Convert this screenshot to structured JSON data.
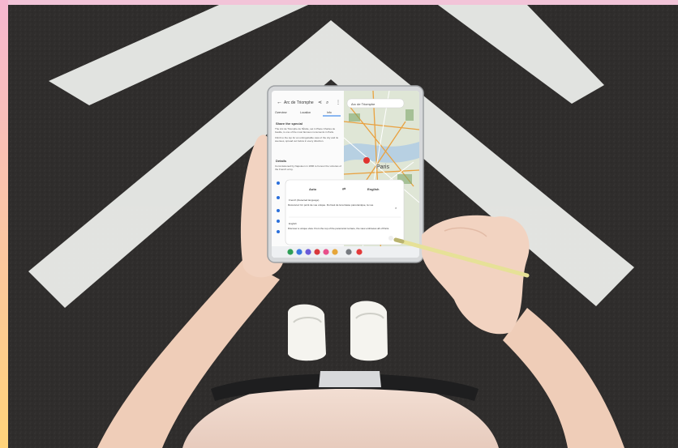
{
  "app": {
    "title": "Arc de Triomphe",
    "tabs": [
      "Overview",
      "Location",
      "Info"
    ],
    "map_search": "Arc de Triomphe",
    "map_city_label": "Paris"
  },
  "article": {
    "heading1": "Share the special",
    "body1": "The Arc de Triomphe de l'Étoile, set in Place Charles de Gaulle, is one of the most famous monuments in Paris.",
    "body2": "Climb to the top for an unforgettable view of the city and its avenues, spread out below in every direction.",
    "heading2": "Details",
    "body3": "Commissioned by Napoleon in 1806 to honour the victories of the French army."
  },
  "translate": {
    "source_lang": "Auto",
    "target_lang": "English",
    "source_label": "French (Detected language)",
    "source_text": "Découvrez Un point de vue unique. Du haut de la terrasse panoramique, la vue",
    "target_label": "English",
    "target_text": "Discover a unique view. From the top of the panoramic terrace, the view embraces all of Paris."
  },
  "colors": {
    "asphalt": "#2e2c2b",
    "stripe": "#e9ebe8",
    "border_pink": "#f2c4d8",
    "pen": "#e6e197",
    "device": "#d6d8da",
    "map_water": "#b7d0e2",
    "map_land": "#dfe6d6"
  },
  "dock_icons": [
    "phone-icon",
    "messages-icon",
    "browser-icon",
    "camera-icon",
    "gallery-icon",
    "play-store-icon",
    "settings-icon",
    "notes-icon"
  ]
}
